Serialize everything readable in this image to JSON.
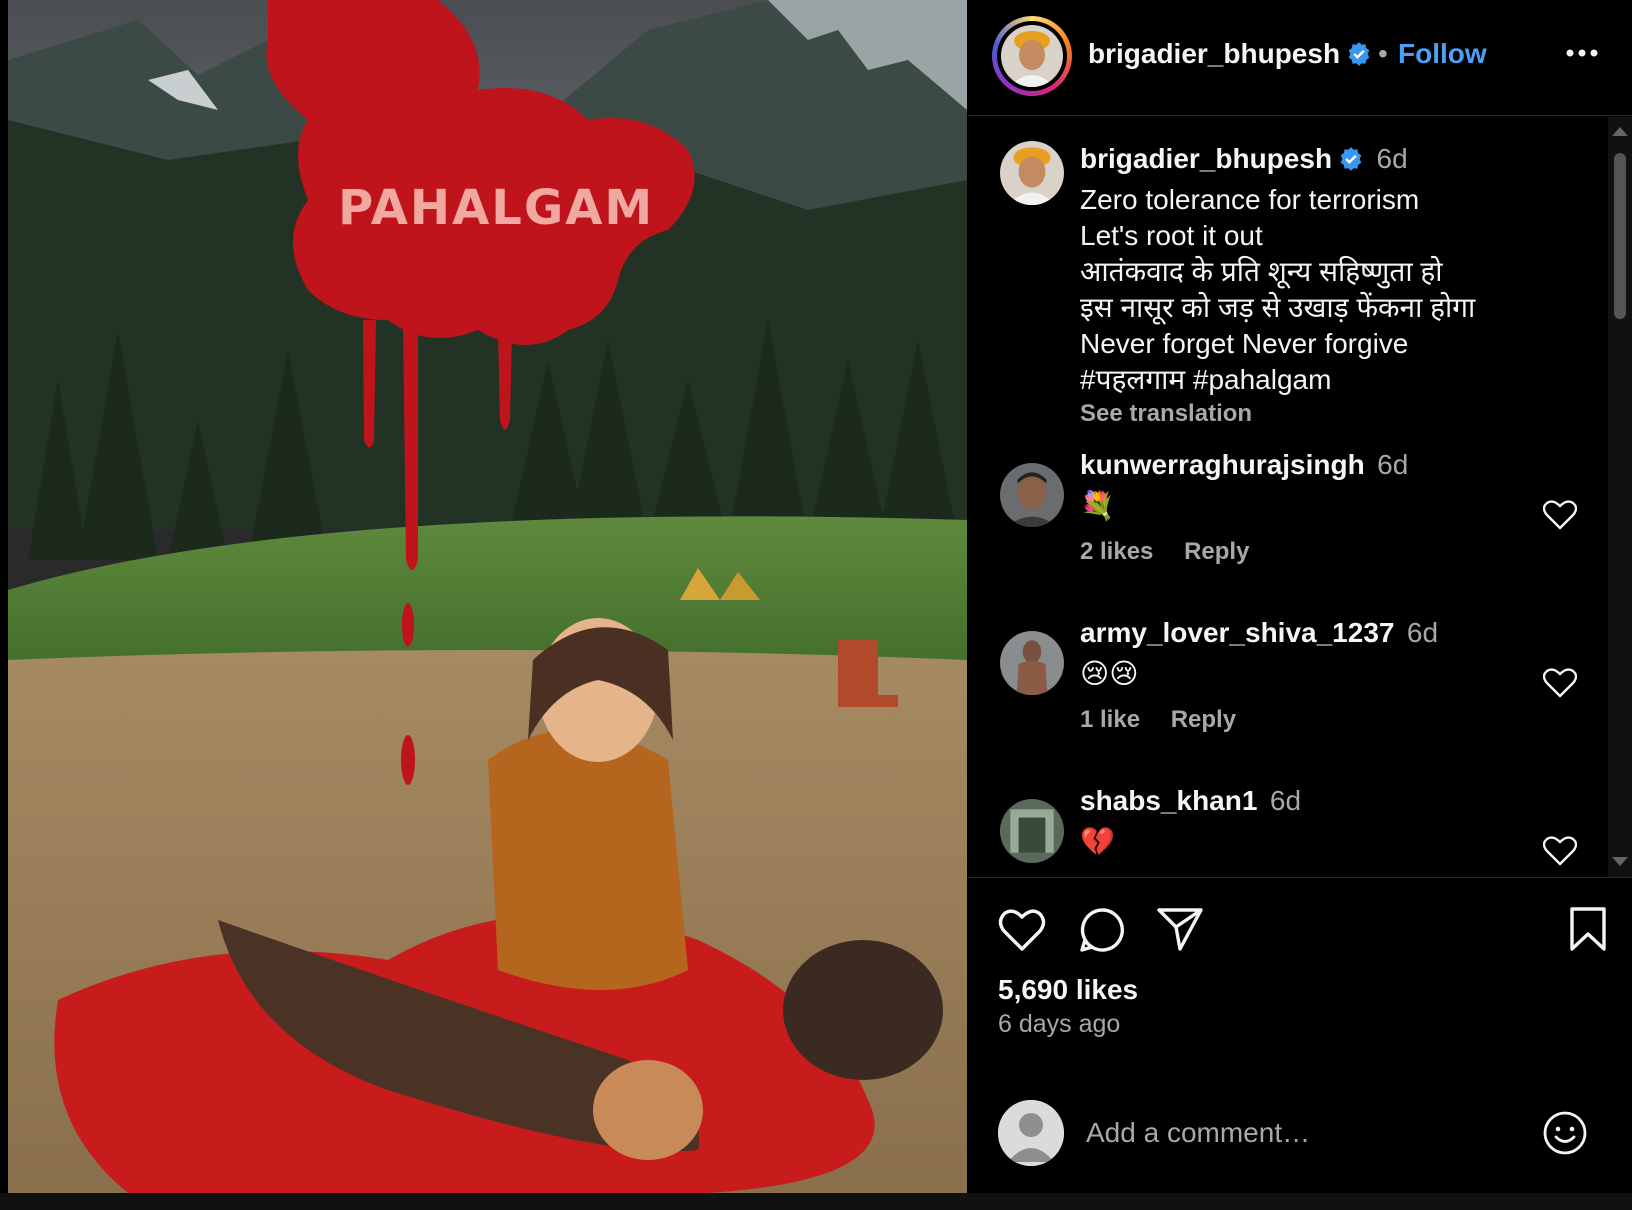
{
  "image": {
    "map_label": "PAHALGAM"
  },
  "header": {
    "username": "brigadier_bhupesh",
    "separator": "•",
    "follow_label": "Follow",
    "more_icon": "more-horizontal-icon"
  },
  "caption": {
    "username": "brigadier_bhupesh",
    "time": "6d",
    "lines": [
      "Zero tolerance for terrorism",
      "Let's root it out",
      "आतंकवाद के प्रति शून्य सहिष्णुता हो",
      "इस नासूर को जड़ से उखाड़ फेंकना होगा",
      "Never forget Never forgive",
      "#पहलगाम #pahalgam"
    ],
    "see_translation": "See translation"
  },
  "comments": [
    {
      "username": "kunwerraghurajsingh",
      "time": "6d",
      "text": "💐",
      "likes": "2 likes",
      "reply": "Reply"
    },
    {
      "username": "army_lover_shiva_1237",
      "time": "6d",
      "text": "😢😢",
      "likes": "1 like",
      "reply": "Reply"
    },
    {
      "username": "shabs_khan1",
      "time": "6d",
      "text": "💔"
    }
  ],
  "actions": {
    "likes": "5,690 likes",
    "time_ago": "6 days ago",
    "comment_placeholder": "Add a comment…"
  },
  "colors": {
    "link_blue": "#4ca0f5",
    "verified_blue": "#3897f0",
    "secondary_text": "#a8a8a8"
  }
}
